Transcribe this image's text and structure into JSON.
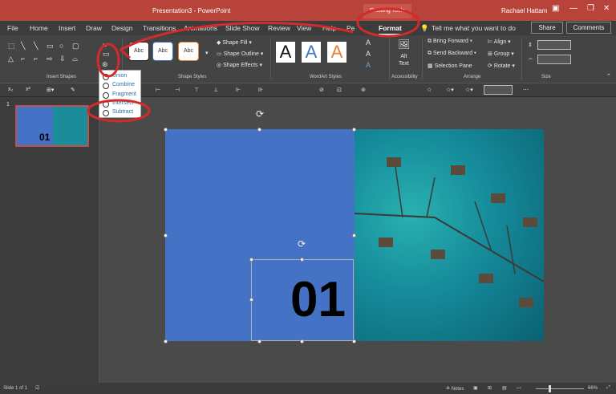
{
  "titlebar": {
    "title": "Presentation3 - PowerPoint",
    "drawing_tools": "Drawing Tools",
    "user": "Rachael Hattam"
  },
  "tabs": [
    "File",
    "Home",
    "Insert",
    "Draw",
    "Design",
    "Transitions",
    "Animations",
    "Slide Show",
    "Review",
    "View",
    "Help",
    "Pe",
    "Format"
  ],
  "tell_me": "Tell me what you want to do",
  "share": "Share",
  "comments": "Comments",
  "ribbon": {
    "insert_shapes_label": "Insert Shapes",
    "shape_styles_label": "Shape Styles",
    "wordart_label": "WordArt Styles",
    "accessibility_label": "Accessibility",
    "arrange_label": "Arrange",
    "size_label": "Size",
    "shape_fill": "Shape Fill",
    "shape_outline": "Shape Outline",
    "shape_effects": "Shape Effects",
    "abc": "Abc",
    "wordart_letter": "A",
    "alt_text": "Alt\nText",
    "bring_forward": "Bring Forward",
    "send_backward": "Send Backward",
    "selection_pane": "Selection Pane",
    "align": "Align",
    "group": "Group",
    "rotate": "Rotate"
  },
  "merge_menu": [
    "Union",
    "Combine",
    "Fragment",
    "Intersect",
    "Subtract"
  ],
  "slide": {
    "number": "1",
    "thumb_text": "01",
    "big_text": "01"
  },
  "status": {
    "slide_info": "Slide 1 of 1",
    "notes": "Notes",
    "zoom": "66%"
  },
  "colors": {
    "accent": "#b8433a",
    "shape_blue": "#4472c4",
    "annotation_red": "#d42a2a"
  }
}
